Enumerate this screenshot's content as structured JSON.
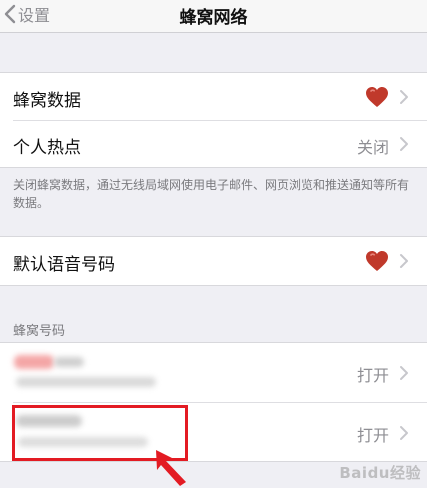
{
  "nav": {
    "back_label": "设置",
    "title": "蜂窝网络"
  },
  "group1": {
    "cellular_data_label": "蜂窝数据",
    "hotspot_label": "个人热点",
    "hotspot_value": "关闭"
  },
  "footer_note": "关闭蜂窝数据，通过无线局域网使用电子邮件、网页浏览和推送通知等所有数据。",
  "group2": {
    "default_voice_label": "默认语音号码"
  },
  "section_header": "蜂窝号码",
  "numbers": [
    {
      "value": "打开"
    },
    {
      "value": "打开"
    }
  ],
  "watermark": "Baidu经验",
  "colors": {
    "accent_red": "#e31b23",
    "chevron": "#c7c7cc",
    "secondary_text": "#8e8e93",
    "heart": "#c0392b"
  }
}
